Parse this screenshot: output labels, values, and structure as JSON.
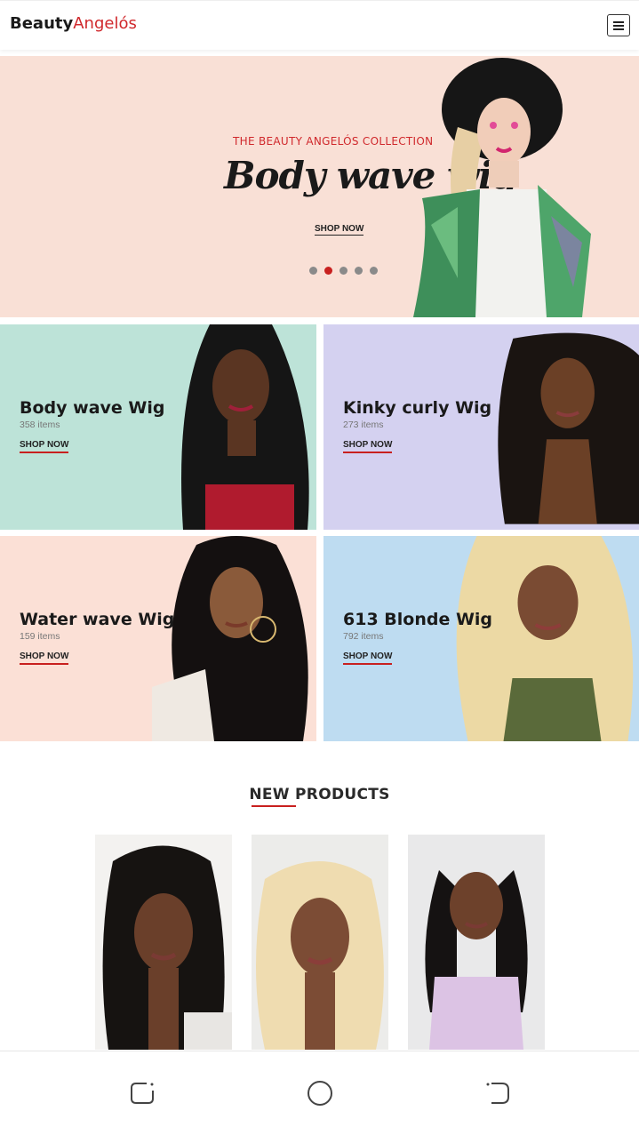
{
  "header": {
    "logo_bold": "Beauty",
    "logo_light": "Angelós",
    "menu_icon": "hamburger-menu-icon"
  },
  "hero": {
    "kicker": "THE BEAUTY ANGELÓS COLLECTION",
    "headline": "Body wave wig",
    "cta": "SHOP NOW",
    "slides_total": 5,
    "active_slide": 2,
    "background": "#f9e0d6"
  },
  "categories": [
    {
      "name": "Body wave Wig",
      "count": "358 items",
      "cta": "SHOP NOW",
      "background": "#bde3d8"
    },
    {
      "name": "Kinky curly Wig",
      "count": "273 items",
      "cta": "SHOP NOW",
      "background": "#d4d1f0"
    },
    {
      "name": "Water wave Wig",
      "count": "159 items",
      "cta": "SHOP NOW",
      "background": "#fbe0d6"
    },
    {
      "name": "613 Blonde Wig",
      "count": "792 items",
      "cta": "SHOP NOW",
      "background": "#bedcf1"
    }
  ],
  "new_products": {
    "title": "NEW PRODUCTS"
  },
  "bottom_nav": {
    "icons": [
      "recent-apps-icon",
      "home-icon",
      "back-icon"
    ]
  },
  "colors": {
    "accent": "#c8201f",
    "logo_accent": "#d0282c"
  }
}
